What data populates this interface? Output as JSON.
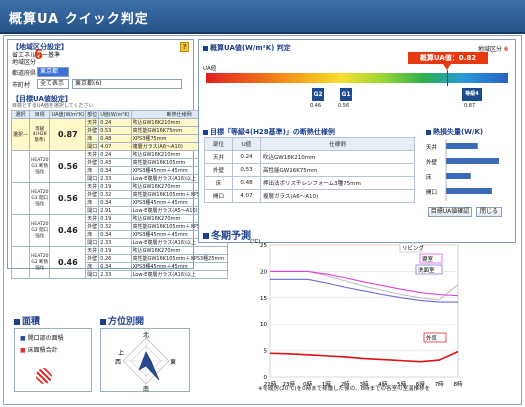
{
  "app": {
    "title": "概算UA クイック判定"
  },
  "left": {
    "region_header": "【地域区分設定】",
    "law_label": "省エネルギー基準",
    "region_label": "地域区分",
    "region_value": "6",
    "pref_label": "都道府県",
    "pref_value": "東京都",
    "city_label": "市町村",
    "city_all": "全て表示",
    "city_value": "東京都(6)",
    "ua_header": "【目標UA値設定】",
    "ua_note": "目標とするUA値を選択してください",
    "table_headers": [
      "選択",
      "目標",
      "UA値(W/m²K)",
      "部位",
      "U値(W/m²K)",
      "断熱仕様例"
    ],
    "selected_label": "選択—",
    "options": [
      {
        "target": "等級4(H28基準)",
        "ua": "0.87",
        "rows": [
          [
            "天井",
            "0.24",
            "吹込GW18K210mm"
          ],
          [
            "外壁",
            "0.53",
            "高性能GW16K75mm"
          ],
          [
            "床",
            "0.48",
            "XPS3種75mm"
          ],
          [
            "開口",
            "4.07",
            "複層ガラス(A6〜A10)"
          ]
        ]
      },
      {
        "target": "HEAT20 G1 断熱強化",
        "ua": "0.56",
        "rows": [
          [
            "天井",
            "0.24",
            "吹込GW18K210mm"
          ],
          [
            "外壁",
            "0.43",
            "高性能GW16K105mm"
          ],
          [
            "床",
            "0.34",
            "XPS3種45mm＋45mm"
          ],
          [
            "開口",
            "2.33",
            "Low-E複層ガラス(A16)以上"
          ]
        ]
      },
      {
        "target": "HEAT20 G1 開口強化",
        "ua": "0.56",
        "rows": [
          [
            "天井",
            "0.19",
            "吹込GW18K270mm"
          ],
          [
            "外壁",
            "0.32",
            "高性能GW16K105mm＋XPS3種25mm"
          ],
          [
            "床",
            "0.34",
            "XPS3種45mm＋45mm"
          ],
          [
            "開口",
            "2.91",
            "Low-E複層ガラス(A5〜A10)"
          ]
        ]
      },
      {
        "target": "HEAT20 G2 開口強化",
        "ua": "0.46",
        "rows": [
          [
            "天井",
            "0.19",
            "吹込GW18K270mm"
          ],
          [
            "外壁",
            "0.32",
            "高性能GW16K105mm＋XPS3種25mm"
          ],
          [
            "床",
            "0.34",
            "XPS3種45mm＋45mm"
          ],
          [
            "開口",
            "2.33",
            "Low-E複層ガラス(A16)以上"
          ]
        ]
      },
      {
        "target": "HEAT20 G2 断熱強化",
        "ua": "0.46",
        "rows": [
          [
            "天井",
            "0.19",
            "吹込GW18K270mm"
          ],
          [
            "外壁",
            "0.26",
            "高性能GW16K105mm＋XPS3種25mm"
          ],
          [
            "床",
            "0.34",
            "XPS3種45mm＋45mm"
          ],
          [
            "開口",
            "2.33",
            "Low-E複層ガラス(A16)以上"
          ]
        ]
      }
    ]
  },
  "right": {
    "header": "概算UA値(W/m²K) 判定",
    "region_tag": "地域区分",
    "region_num": "6",
    "ua_axis": "UA値",
    "callout": "概算UA値：0.82",
    "g2": "G2",
    "g2_val": "0.46",
    "g1": "G1",
    "g1_val": "0.56",
    "grade": "等級4",
    "grade_val": "0.87",
    "spec_header": "目標「等級4(H28基準)」の断熱仕様例",
    "spec_cols": [
      "部位",
      "U値",
      "仕様例"
    ],
    "spec_rows": [
      [
        "天井",
        "0.24",
        "吹込GW18K210mm"
      ],
      [
        "外壁",
        "0.53",
        "高性能GW16K75mm"
      ],
      [
        "床",
        "0.48",
        "押出法ポリスチレンフォーム3種75mm"
      ],
      [
        "開口",
        "4.07",
        "複層ガラス(A6〜A10)"
      ]
    ],
    "loss_header": "熱損失量(W/K)",
    "loss_labels": [
      "天井",
      "外壁",
      "床",
      "開口"
    ],
    "loss_values": [
      18,
      30,
      14,
      26
    ],
    "btn_detail": "目標UA値確認",
    "btn_close": "閉じる"
  },
  "winter": {
    "title": "冬期予測",
    "yunit": "(℃)",
    "yticks": [
      "25",
      "20",
      "15",
      "10",
      "5",
      "0"
    ],
    "xticks": [
      "22時",
      "23時",
      "0時",
      "1時",
      "2時",
      "3時",
      "4時",
      "5時",
      "6時",
      "7時",
      "8時"
    ],
    "note": "※冬暖房(20℃)を0時まで稼働した後の、8時までの各室の室温推移を",
    "chart_data": {
      "type": "line",
      "x": [
        "22時",
        "23時",
        "0時",
        "1時",
        "2時",
        "3時",
        "4時",
        "5時",
        "6時",
        "7時",
        "8時"
      ],
      "ylim": [
        0,
        25
      ],
      "series": [
        {
          "name": "リビング",
          "color": "#c0c0c0",
          "values": [
            20,
            20,
            20,
            19.2,
            18.2,
            17.2,
            16.4,
            15.6,
            15.0,
            14.6,
            17.5
          ]
        },
        {
          "name": "寝室",
          "color": "#e040e0",
          "values": [
            20,
            20,
            20,
            19.5,
            18.8,
            18.0,
            17.3,
            16.6,
            16.0,
            15.6,
            15.4
          ]
        },
        {
          "name": "洗面室",
          "color": "#6a6ad8",
          "values": [
            18.5,
            18.5,
            18.5,
            17.8,
            17.0,
            16.3,
            15.6,
            15.0,
            14.5,
            14.2,
            14.2
          ]
        },
        {
          "name": "外気",
          "color": "#e01010",
          "values": [
            4.5,
            4.4,
            4.2,
            4.0,
            3.8,
            3.5,
            3.3,
            3.1,
            2.9,
            3.2,
            4.8
          ]
        }
      ]
    }
  },
  "bottom": {
    "area_title": "面積",
    "area_items": [
      "開口部の面積",
      "床面積合計"
    ],
    "dir_title": "方位別開",
    "compass": [
      "北",
      "東",
      "南",
      "西",
      "上"
    ]
  },
  "colors": {
    "title_bg": "#2d5c96",
    "accent": "#e8380f",
    "heading": "#1c3f8c"
  }
}
